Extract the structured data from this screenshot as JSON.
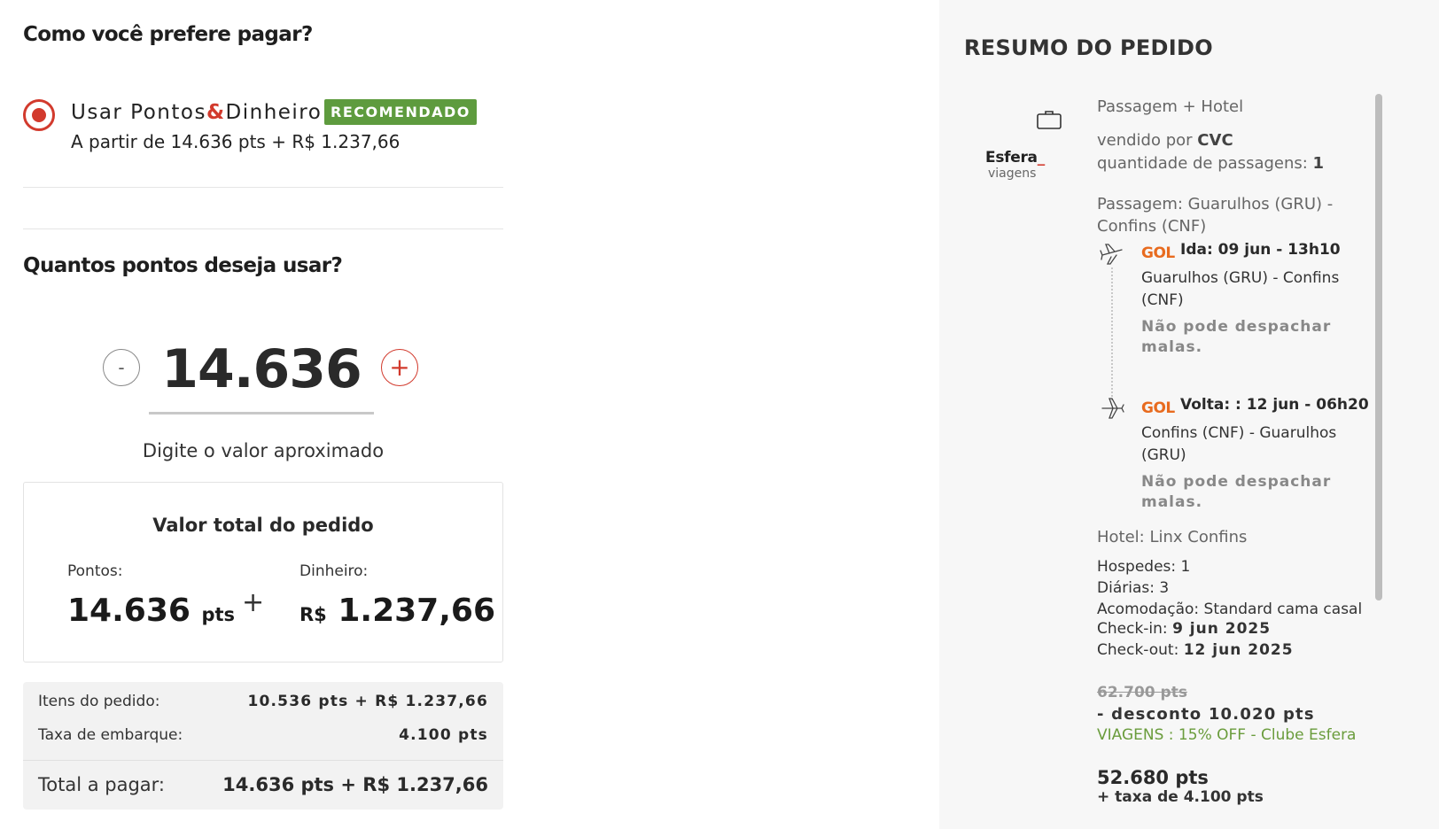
{
  "payment": {
    "title": "Como você prefere pagar?",
    "option_label_prefix": "Usar Pontos",
    "option_label_amp": "&",
    "option_label_suffix": "Dinheiro",
    "badge": "RECOMENDADO",
    "option_subtitle": "A partir de 14.636 pts + R$ 1.237,66"
  },
  "points": {
    "title": "Quantos pontos deseja usar?",
    "minus_label": "-",
    "plus_label": "+",
    "value": "14.636",
    "hint": "Digite o valor aproximado"
  },
  "total_box": {
    "title": "Valor total do pedido",
    "points_label": "Pontos:",
    "points_value": "14.636",
    "points_unit": "pts",
    "plus": "+",
    "money_label": "Dinheiro:",
    "money_currency": "R$",
    "money_value": "1.237,66"
  },
  "summary": {
    "items_label": "Itens do pedido:",
    "items_value": "10.536 pts + R$ 1.237,66",
    "tax_label": "Taxa de embarque:",
    "tax_value": "4.100 pts",
    "total_label": "Total a pagar:",
    "total_value": "14.636 pts + R$ 1.237,66"
  },
  "order": {
    "title": "RESUMO DO PEDIDO",
    "logo_main": "Esfera",
    "logo_underscore": "_",
    "logo_sub": "viagens",
    "package_type": "Passagem + Hotel",
    "sold_by_label": "vendido por ",
    "sold_by_value": "CVC",
    "qty_label": "quantidade de passagens: ",
    "qty_value": "1",
    "route": "Passagem: Guarulhos (GRU) - Confins (CNF)",
    "airline": "GOL",
    "outbound": {
      "head": "Ida: 09 jun - 13h10",
      "route": "Guarulhos (GRU) - Confins (CNF)",
      "baggage": "Não pode despachar malas."
    },
    "inbound": {
      "head": "Volta: : 12 jun - 06h20",
      "route": "Confins (CNF) - Guarulhos (GRU)",
      "baggage": "Não pode despachar malas."
    },
    "hotel": "Hotel: Linx Confins",
    "guests": "Hospedes: 1",
    "nights": "Diárias: 3",
    "room": "Acomodação: Standard cama casal",
    "checkin_label": "Check-in: ",
    "checkin_value": "9 jun 2025",
    "checkout_label": "Check-out: ",
    "checkout_value": "12 jun 2025",
    "old_price": "62.700 pts",
    "discount": "- desconto 10.020 pts",
    "promo": "VIAGENS : 15% OFF - Clube Esfera",
    "final_price": "52.680 pts",
    "tax_line": "+ taxa de 4.100 pts"
  }
}
